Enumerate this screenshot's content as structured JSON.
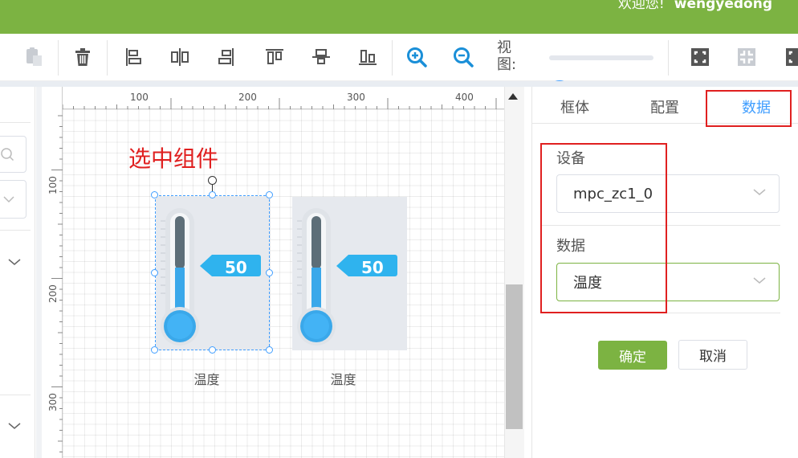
{
  "header": {
    "welcome_text": "欢迎您!",
    "username": "wengyedong"
  },
  "toolbar": {
    "view_label": "视图:",
    "zoom_level": 0.15,
    "icons": [
      "paste-icon",
      "delete-icon",
      "align-left-icon",
      "align-center-h-icon",
      "align-right-icon",
      "align-top-icon",
      "align-middle-icon",
      "align-bottom-icon",
      "zoom-in-icon",
      "zoom-out-icon",
      "fit-screen-icon",
      "actual-size-icon",
      "fullscreen-icon"
    ]
  },
  "ruler": {
    "h_ticks": [
      "100",
      "200",
      "300",
      "400"
    ],
    "v_ticks": [
      "100",
      "200",
      "300"
    ]
  },
  "canvas": {
    "annotation": "选中组件",
    "widgets": [
      {
        "value": "50",
        "label": "温度",
        "selected": true
      },
      {
        "value": "50",
        "label": "温度",
        "selected": false
      }
    ]
  },
  "right_panel": {
    "tabs": [
      {
        "label": "框体",
        "active": false
      },
      {
        "label": "配置",
        "active": false
      },
      {
        "label": "数据",
        "active": true
      }
    ],
    "device_label": "设备",
    "device_value": "mpc_zc1_0",
    "data_label": "数据",
    "data_value": "温度",
    "ok_label": "确定",
    "cancel_label": "取消"
  },
  "colors": {
    "brand_green": "#7cb342",
    "accent_blue": "#409eff",
    "annotation_red": "#e02020"
  }
}
